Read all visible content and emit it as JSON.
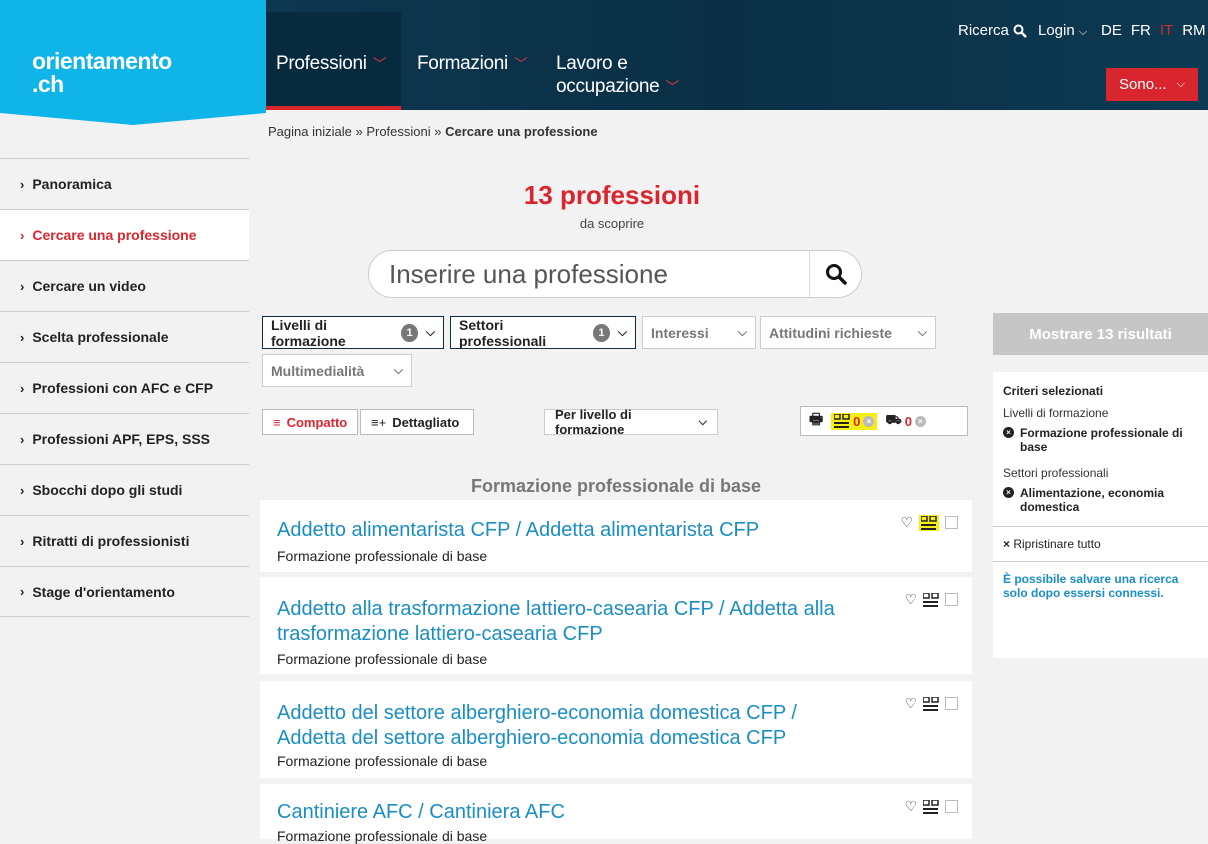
{
  "brand": {
    "line1": "orientamento",
    "line2": ".ch"
  },
  "nav": {
    "items": [
      {
        "label": "Professioni"
      },
      {
        "label": "Formazioni"
      },
      {
        "label_line1": "Lavoro e",
        "label_line2": "occupazione"
      }
    ]
  },
  "utility": {
    "search_label": "Ricerca",
    "login_label": "Login",
    "langs": [
      "DE",
      "FR",
      "IT",
      "RM"
    ],
    "sono_label": "Sono..."
  },
  "breadcrumb": {
    "home": "Pagina iniziale",
    "sep": "»",
    "section": "Professioni",
    "current": "Cercare una professione"
  },
  "sidebar": {
    "items": [
      {
        "label": "Panoramica"
      },
      {
        "label": "Cercare una professione"
      },
      {
        "label": "Cercare un video"
      },
      {
        "label": "Scelta professionale"
      },
      {
        "label": "Professioni con AFC e CFP"
      },
      {
        "label": "Professioni APF, EPS, SSS"
      },
      {
        "label": "Sbocchi dopo gli studi"
      },
      {
        "label": "Ritratti di professionisti"
      },
      {
        "label": "Stage d'orientamento"
      }
    ]
  },
  "results": {
    "count_text": "13 professioni",
    "sub": "da scoprire"
  },
  "search": {
    "placeholder": "Inserire una professione"
  },
  "filters": {
    "livelli": {
      "label": "Livelli di formazione",
      "badge": "1"
    },
    "settori": {
      "label": "Settori professionali",
      "badge": "1"
    },
    "interessi": {
      "label": "Interessi"
    },
    "attitudini": {
      "label": "Attitudini richieste"
    },
    "multimedia": {
      "label": "Multimedialità"
    }
  },
  "view": {
    "compact_label": "Compatto",
    "detailed_label": "Dettagliato",
    "sort_label": "Per livello di formazione",
    "compare_count": "0",
    "basket_count": "0"
  },
  "group": {
    "title": "Formazione professionale di base"
  },
  "cards": [
    {
      "title": "Addetto alimentarista CFP / Addetta alimentarista CFP",
      "sub": "Formazione professionale di base"
    },
    {
      "title_line1": "Addetto alla trasformazione lattiero-casearia CFP / Addetta alla",
      "title_line2": "trasformazione lattiero-casearia CFP",
      "sub": "Formazione professionale di base"
    },
    {
      "title_line1": "Addetto del settore alberghiero-economia domestica CFP /",
      "title_line2": "Addetta del settore alberghiero-economia domestica CFP",
      "sub": "Formazione professionale di base"
    },
    {
      "title": "Cantiniere AFC / Cantiniera AFC",
      "sub": "Formazione professionale di base"
    }
  ],
  "right": {
    "show_label": "Mostrare 13 risultati",
    "criteria_title": "Criteri selezionati",
    "crit1_label": "Livelli di formazione",
    "crit1_value": "Formazione professionale di base",
    "crit2_label": "Settori professionali",
    "crit2_value": "Alimentazione, economia domestica",
    "reset_label": "Ripristinare tutto",
    "note": "È possibile salvare una ricerca solo dopo essersi connessi."
  },
  "colors": {
    "brand_cyan": "#0fb4e8",
    "header_navy": "#0a2f45",
    "accent_red": "#d9262e",
    "link_blue": "#1a8ec4",
    "highlight_yellow": "#f5ef14"
  }
}
